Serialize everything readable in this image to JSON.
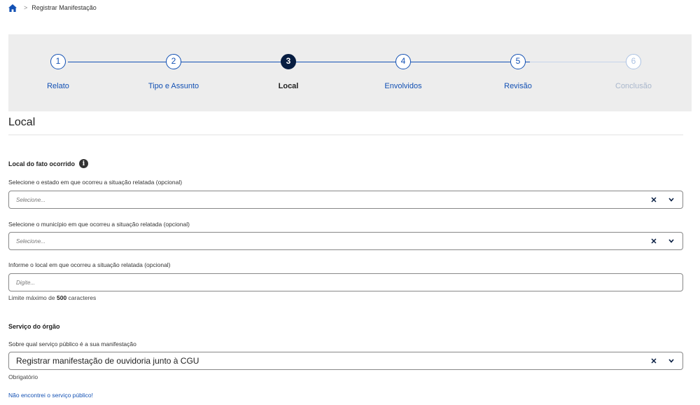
{
  "breadcrumb": {
    "home_icon": "home-icon",
    "separator": ">",
    "current": "Registrar Manifestação"
  },
  "stepper": {
    "steps": [
      {
        "number": "1",
        "label": "Relato",
        "state": "done"
      },
      {
        "number": "2",
        "label": "Tipo e Assunto",
        "state": "done"
      },
      {
        "number": "3",
        "label": "Local",
        "state": "active"
      },
      {
        "number": "4",
        "label": "Envolvidos",
        "state": "todo"
      },
      {
        "number": "5",
        "label": "Revisão",
        "state": "todo"
      },
      {
        "number": "6",
        "label": "Conclusão",
        "state": "disabled"
      }
    ]
  },
  "section": {
    "title": "Local"
  },
  "local": {
    "group_title": "Local do fato ocorrido",
    "info_icon": "i",
    "estado": {
      "label": "Selecione o estado em que ocorreu a situação relatada (opcional)",
      "placeholder": "Selecione..."
    },
    "municipio": {
      "label": "Selecione o município em que ocorreu a situação relatada (opcional)",
      "placeholder": "Selecione..."
    },
    "local": {
      "label": "Informe o local em que ocorreu a situação relatada (opcional)",
      "placeholder": "Digite..."
    },
    "limit_prefix": "Limite máximo de",
    "limit_value": "500",
    "limit_suffix": "caracteres"
  },
  "servico": {
    "group_title": "Serviço do órgão",
    "label": "Sobre qual serviço público é a sua manifestação",
    "value": "Registrar manifestação de ouvidoria junto à CGU",
    "required_hint": "Obrigatório",
    "not_found_link": "Não encontrei o serviço público!"
  },
  "icons": {
    "clear": "✕",
    "chevron": "⌄"
  },
  "colors": {
    "primary": "#1351b4",
    "dark": "#071d41",
    "stepper_bg": "#ededed"
  }
}
